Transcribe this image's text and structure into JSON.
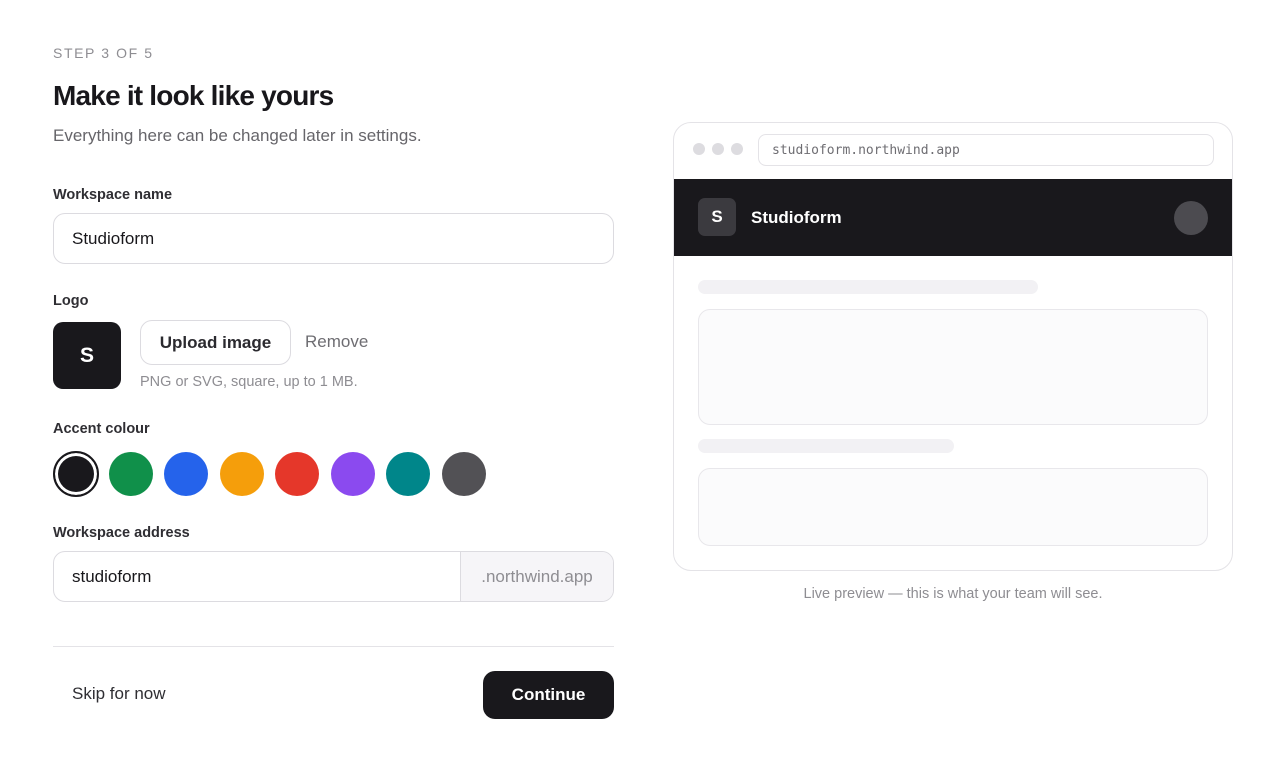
{
  "step": "STEP 3 OF 5",
  "title": "Make it look like yours",
  "subtitle": "Everything here can be changed later in settings.",
  "workspace_name": {
    "label": "Workspace name",
    "value": "Studioform"
  },
  "logo": {
    "label": "Logo",
    "initial": "S",
    "upload_label": "Upload image",
    "remove_label": "Remove",
    "hint": "PNG or SVG, square, up to 1 MB."
  },
  "accent": {
    "label": "Accent colour",
    "selected": "#19181c",
    "options": [
      "#19181c",
      "#10904a",
      "#2563eb",
      "#f59e0b",
      "#e5372a",
      "#8b4aef",
      "#00868a",
      "#525155"
    ]
  },
  "address": {
    "label": "Workspace address",
    "value": "studioform",
    "suffix": ".northwind.app"
  },
  "footer": {
    "skip_label": "Skip for now",
    "continue_label": "Continue"
  },
  "preview": {
    "url": "studioform.northwind.app",
    "logo_initial": "S",
    "app_name": "Studioform",
    "caption": "Live preview — this is what your team will see."
  }
}
